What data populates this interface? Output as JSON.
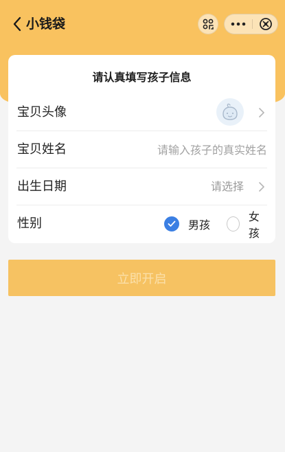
{
  "nav": {
    "title": "小钱袋",
    "icons": {
      "back": "chevron-left-icon",
      "scan": "scan-icon",
      "more": "more-dots-icon",
      "close": "close-circle-icon"
    }
  },
  "colors": {
    "brand": "#f9c25f",
    "button": "#f6c262",
    "button_text": "#fbe0aa",
    "radio_checked": "#3b7fe3",
    "background": "#f4f4f4"
  },
  "form": {
    "title": "请认真填写孩子信息",
    "avatar_row": {
      "label": "宝贝头像",
      "icon": "baby-avatar-icon"
    },
    "name_row": {
      "label": "宝贝姓名",
      "placeholder": "请输入孩子的真实姓名",
      "value": ""
    },
    "birth_row": {
      "label": "出生日期",
      "value": "请选择"
    },
    "gender_row": {
      "label": "性别",
      "options": [
        {
          "label": "男孩",
          "checked": true
        },
        {
          "label": "女孩",
          "checked": false
        }
      ]
    }
  },
  "submit": {
    "label": "立即开启",
    "enabled": false
  }
}
